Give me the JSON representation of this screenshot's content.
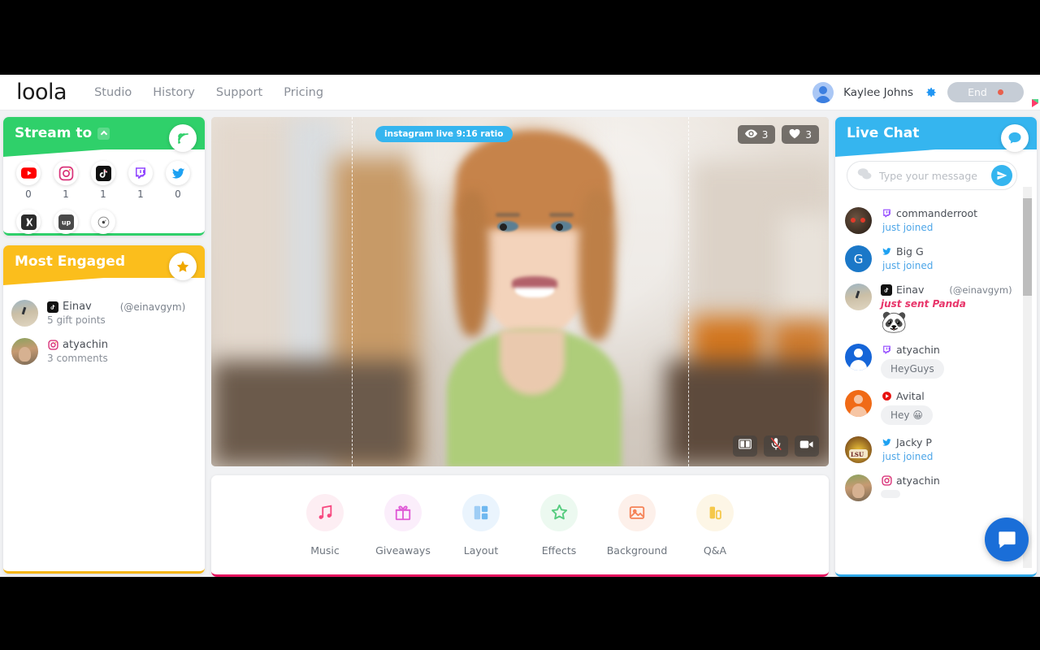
{
  "header": {
    "logo_text": "loola",
    "nav": [
      {
        "label": "Studio",
        "name": "studio"
      },
      {
        "label": "History",
        "name": "history"
      },
      {
        "label": "Support",
        "name": "support"
      },
      {
        "label": "Pricing",
        "name": "pricing"
      }
    ],
    "user_name": "Kaylee Johns",
    "settings_icon": "gear-icon",
    "end_label": "End"
  },
  "stream_panel": {
    "title": "Stream to",
    "badge_icon": "broadcast-icon",
    "accent": "#2fd06a",
    "platforms_row1": [
      {
        "name": "youtube",
        "count": "0",
        "glyph": "▶",
        "color": "#ff0000"
      },
      {
        "name": "instagram",
        "count": "1",
        "glyph": "◎",
        "color": "#d9347a"
      },
      {
        "name": "tiktok",
        "count": "1",
        "glyph": "♪",
        "color": "#111111"
      },
      {
        "name": "twitch",
        "count": "1",
        "glyph": "▣",
        "color": "#9146ff"
      },
      {
        "name": "twitter",
        "count": "0",
        "glyph": "🐦",
        "color": "#1da1f2"
      }
    ],
    "platforms_row2": [
      {
        "name": "kick",
        "glyph": "K",
        "color": "#2b2b2b"
      },
      {
        "name": "vk",
        "glyph": "up",
        "color": "#4a4a4a"
      },
      {
        "name": "custom-rtmp",
        "glyph": "◉",
        "color": "#8b8b8b"
      }
    ]
  },
  "engaged_panel": {
    "title": "Most Engaged",
    "badge_icon": "star-icon",
    "accent": "#fbbe1c",
    "items": [
      {
        "name": "Einav",
        "handle": "(@einavgym)",
        "sub": "5 gift points",
        "platform": "tiktok",
        "avatar": "photo-beach"
      },
      {
        "name": "atyachin",
        "handle": "",
        "sub": "3 comments",
        "platform": "instagram",
        "avatar": "photo-man"
      }
    ]
  },
  "stage": {
    "ratio_badge": "instagram live 9:16 ratio",
    "viewers": "3",
    "likes": "3",
    "viewers_icon": "eye-icon",
    "likes_icon": "heart-icon",
    "controls": [
      {
        "name": "split-view-button",
        "icon": "book-icon"
      },
      {
        "name": "mute-mic-button",
        "icon": "microphone-muted-icon"
      },
      {
        "name": "camera-button",
        "icon": "video-camera-icon"
      }
    ]
  },
  "tools": [
    {
      "label": "Music",
      "name": "music",
      "icon": "music-note-icon",
      "color": "#f7487f",
      "bg": "#fdeef3"
    },
    {
      "label": "Giveaways",
      "name": "giveaways",
      "icon": "gift-icon",
      "color": "#e05ad6",
      "bg": "#fbeefb"
    },
    {
      "label": "Layout",
      "name": "layout",
      "icon": "layout-grid-icon",
      "color": "#6fb8f0",
      "bg": "#eaf4fd"
    },
    {
      "label": "Effects",
      "name": "effects",
      "icon": "star-outline-icon",
      "color": "#56cc7f",
      "bg": "#ecf9f0"
    },
    {
      "label": "Background",
      "name": "background",
      "icon": "image-icon",
      "color": "#f58257",
      "bg": "#fdf0ea"
    },
    {
      "label": "Q&A",
      "name": "qa",
      "icon": "bars-icon",
      "color": "#f5c84b",
      "bg": "#fdf6e6"
    }
  ],
  "chat": {
    "title": "Live Chat",
    "badge_icon": "chat-bubble-icon",
    "accent": "#35b5ef",
    "placeholder": "Type your message",
    "send_icon": "send-icon",
    "messages": [
      {
        "name": "commanderroot",
        "handle": "",
        "platform": "twitch",
        "avatar": "photo-mask",
        "status": "just joined",
        "text": "",
        "emoji": ""
      },
      {
        "name": "Big G",
        "handle": "",
        "platform": "twitter",
        "avatar": "letter-G",
        "status": "just joined",
        "text": "",
        "emoji": ""
      },
      {
        "name": "Einav",
        "handle": "(@einavgym)",
        "platform": "tiktok",
        "avatar": "photo-beach",
        "status": "",
        "gift": "just sent Panda",
        "emoji": "🐼",
        "text": ""
      },
      {
        "name": "atyachin",
        "handle": "",
        "platform": "twitch",
        "avatar": "person-blue",
        "status": "",
        "text": "HeyGuys",
        "emoji": ""
      },
      {
        "name": "Avital",
        "handle": "",
        "platform": "youtube",
        "avatar": "person-orange",
        "status": "",
        "text": "Hey 😀",
        "emoji": ""
      },
      {
        "name": "Jacky P",
        "handle": "",
        "platform": "twitter",
        "avatar": "photo-lsu",
        "status": "just joined",
        "text": "",
        "emoji": ""
      },
      {
        "name": "atyachin",
        "handle": "",
        "platform": "instagram",
        "avatar": "photo-man",
        "status": "",
        "text": "",
        "emoji": ""
      }
    ]
  },
  "intercom": {
    "icon": "intercom-chat-icon"
  }
}
